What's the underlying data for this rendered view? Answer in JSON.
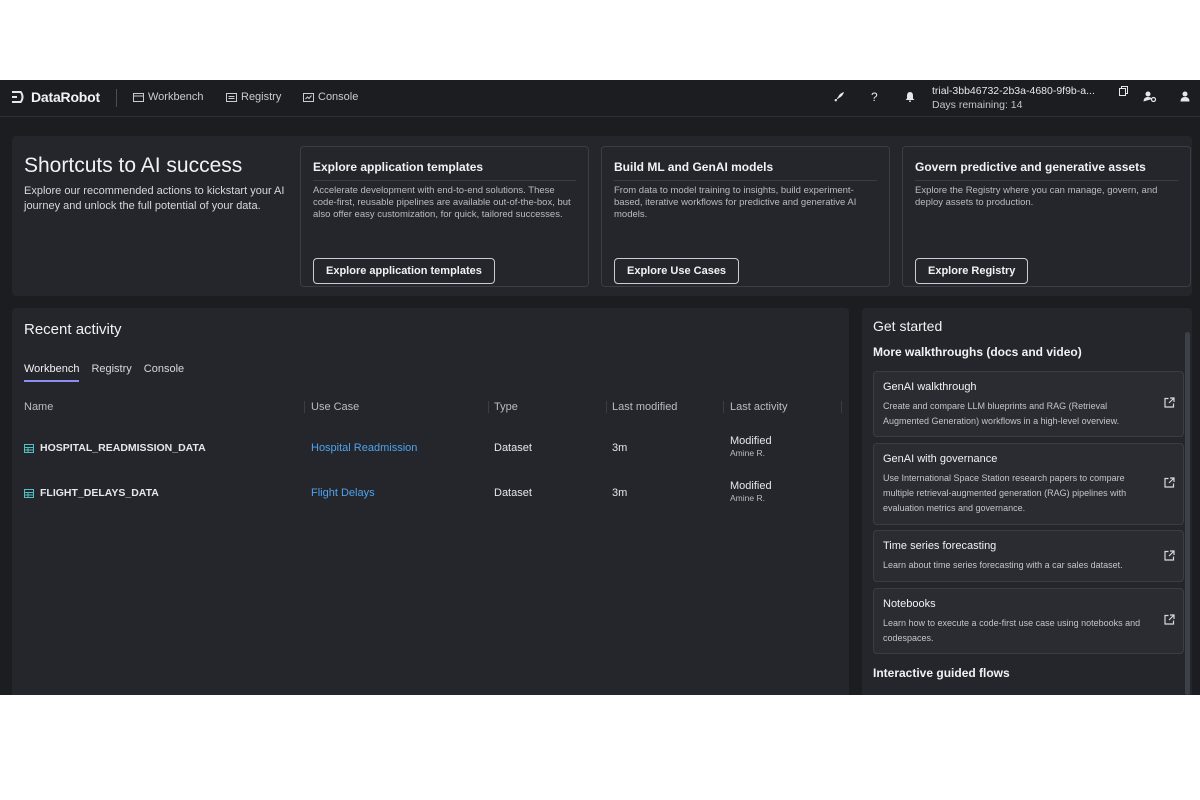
{
  "header": {
    "logo_text": "DataRobot",
    "nav": [
      {
        "label": "Workbench",
        "icon": "workbench-icon"
      },
      {
        "label": "Registry",
        "icon": "registry-icon"
      },
      {
        "label": "Console",
        "icon": "console-icon"
      }
    ],
    "account_name": "trial-3bb46732-2b3a-4680-9f9b-a...",
    "days_remaining": "Days remaining: 14"
  },
  "shortcuts": {
    "title": "Shortcuts to AI success",
    "description": "Explore our recommended actions to kickstart your AI journey and unlock the full potential of your data.",
    "cards": [
      {
        "title": "Explore application templates",
        "description": "Accelerate development with end-to-end solutions. These code-first, reusable pipelines are available out-of-the-box, but also offer easy customization, for quick, tailored successes.",
        "button": "Explore application templates"
      },
      {
        "title": "Build ML and GenAI models",
        "description": "From data to model training to insights, build experiment-based, iterative workflows for predictive and generative AI models.",
        "button": "Explore Use Cases"
      },
      {
        "title": "Govern predictive and generative assets",
        "description": "Explore the Registry where you can manage, govern, and deploy assets to production.",
        "button": "Explore Registry"
      }
    ]
  },
  "recent": {
    "title": "Recent activity",
    "tabs": [
      "Workbench",
      "Registry",
      "Console"
    ],
    "active_tab": "Workbench",
    "columns": [
      "Name",
      "Use Case",
      "Type",
      "Last modified",
      "Last activity"
    ],
    "rows": [
      {
        "name": "HOSPITAL_READMISSION_DATA",
        "use_case": "Hospital Readmission",
        "type": "Dataset",
        "modified": "3m",
        "activity": "Modified",
        "user": "Amine R."
      },
      {
        "name": "FLIGHT_DELAYS_DATA",
        "use_case": "Flight Delays",
        "type": "Dataset",
        "modified": "3m",
        "activity": "Modified",
        "user": "Amine R."
      }
    ]
  },
  "get_started": {
    "title": "Get started",
    "walkthroughs_heading": "More walkthroughs (docs and video)",
    "walkthroughs": [
      {
        "title": "GenAI walkthrough",
        "description": "Create and compare LLM blueprints and RAG (Retrieval Augmented Generation) workflows in a high-level overview."
      },
      {
        "title": "GenAI with governance",
        "description": "Use International Space Station research papers to compare multiple retrieval-augmented generation (RAG) pipelines with evaluation metrics and governance."
      },
      {
        "title": "Time series forecasting",
        "description": "Learn about time series forecasting with a car sales dataset."
      },
      {
        "title": "Notebooks",
        "description": "Learn how to execute a code-first use case using notebooks and codespaces."
      }
    ],
    "flows_heading": "Interactive guided flows"
  },
  "colors": {
    "background": "#1b1d21",
    "panel": "#24262b",
    "link": "#4ea3ee",
    "tab_accent": "#8d8ff0",
    "dataset_icon": "#4fc3c3"
  }
}
